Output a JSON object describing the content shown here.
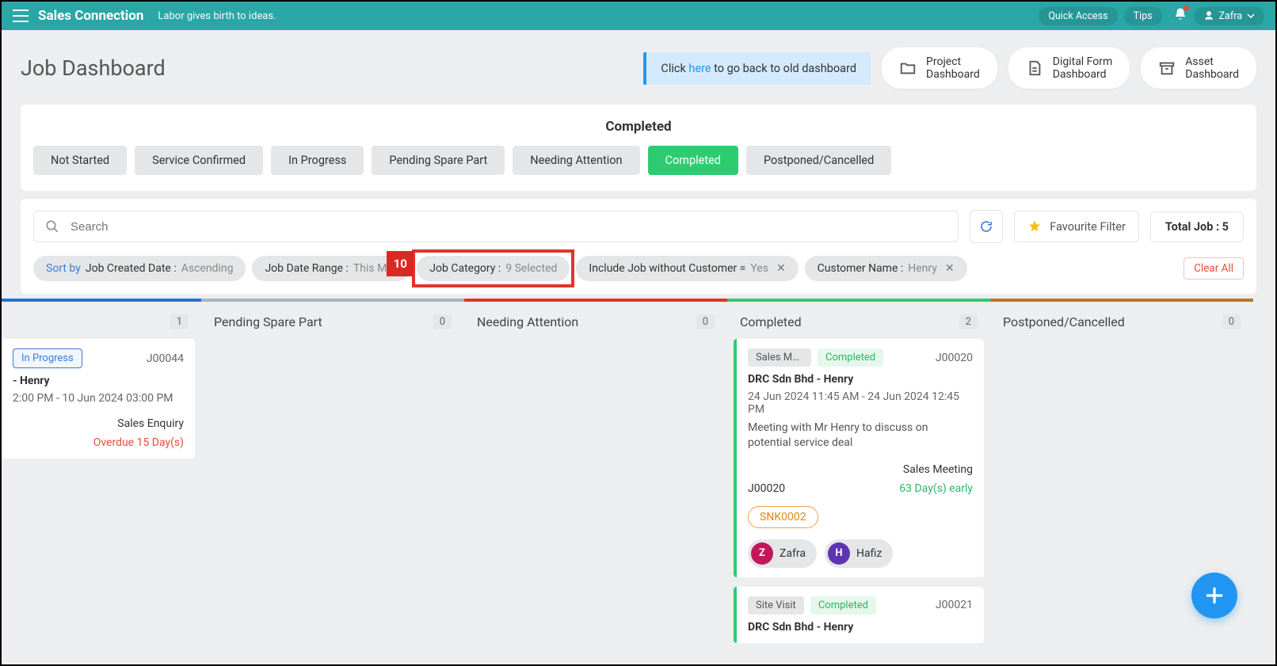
{
  "topbar": {
    "brand": "Sales Connection",
    "tagline": "Labor gives birth to ideas.",
    "quick_access": "Quick Access",
    "tips": "Tips",
    "user": "Zafra"
  },
  "header": {
    "title": "Job Dashboard",
    "banner_prefix": "Click ",
    "banner_link": "here",
    "banner_suffix": " to go back to old dashboard",
    "nav": [
      {
        "line1": "Project",
        "line2": "Dashboard"
      },
      {
        "line1": "Digital Form",
        "line2": "Dashboard"
      },
      {
        "line1": "Asset",
        "line2": "Dashboard"
      }
    ]
  },
  "panel": {
    "title": "Completed",
    "tabs": [
      "Not Started",
      "Service Confirmed",
      "In Progress",
      "Pending Spare Part",
      "Needing Attention",
      "Completed",
      "Postponed/Cancelled"
    ],
    "active_index": 5
  },
  "filters": {
    "search_placeholder": "Search",
    "favourite": "Favourite Filter",
    "total_label": "Total Job : ",
    "total_value": "5",
    "clear_all": "Clear All",
    "sort_prefix": "Sort by",
    "sort_field": "Job Created Date : ",
    "sort_dir": "Ascending",
    "chip_dr_label": "Job Date Range : ",
    "chip_dr_val": "This M",
    "chip_cat_label": "Job Category : ",
    "chip_cat_val": "9 Selected",
    "chip_inc_label": "Include Job without Customer = ",
    "chip_inc_val": "Yes",
    "chip_cust_label": "Customer Name : ",
    "chip_cust_val": "Henry",
    "callout": "10"
  },
  "columns": [
    {
      "title": "",
      "count": "1",
      "bar": "#2b6fd6"
    },
    {
      "title": "Pending Spare Part",
      "count": "0",
      "bar": "#a7b3bd"
    },
    {
      "title": "Needing Attention",
      "count": "0",
      "bar": "#e3332b"
    },
    {
      "title": "Completed",
      "count": "2",
      "bar": "#2ecc71"
    },
    {
      "title": "Postponed/Cancelled",
      "count": "0",
      "bar": "#b37a28"
    }
  ],
  "cards": {
    "inprog": {
      "status": "In Progress",
      "jobno": "J00044",
      "company": "- Henry",
      "dt": "2:00 PM - 10 Jun 2024 03:00 PM",
      "category": "Sales Enquiry",
      "overdue": "Overdue 15 Day(s)"
    },
    "c1": {
      "cat": "Sales Me…",
      "status": "Completed",
      "jobno": "J00020",
      "company": "DRC Sdn Bhd - Henry",
      "dt": "24 Jun 2024 11:45 AM - 24 Jun 2024 12:45 PM",
      "desc": "Meeting with Mr Henry to discuss on potential service deal",
      "ref": "J00020",
      "category": "Sales Meeting",
      "early": "63 Day(s) early",
      "tag": "SNK0002",
      "av1_initial": "Z",
      "av1_name": "Zafra",
      "av2_initial": "H",
      "av2_name": "Hafiz"
    },
    "c2": {
      "cat": "Site Visit",
      "status": "Completed",
      "jobno": "J00021",
      "company": "DRC Sdn Bhd - Henry"
    }
  }
}
